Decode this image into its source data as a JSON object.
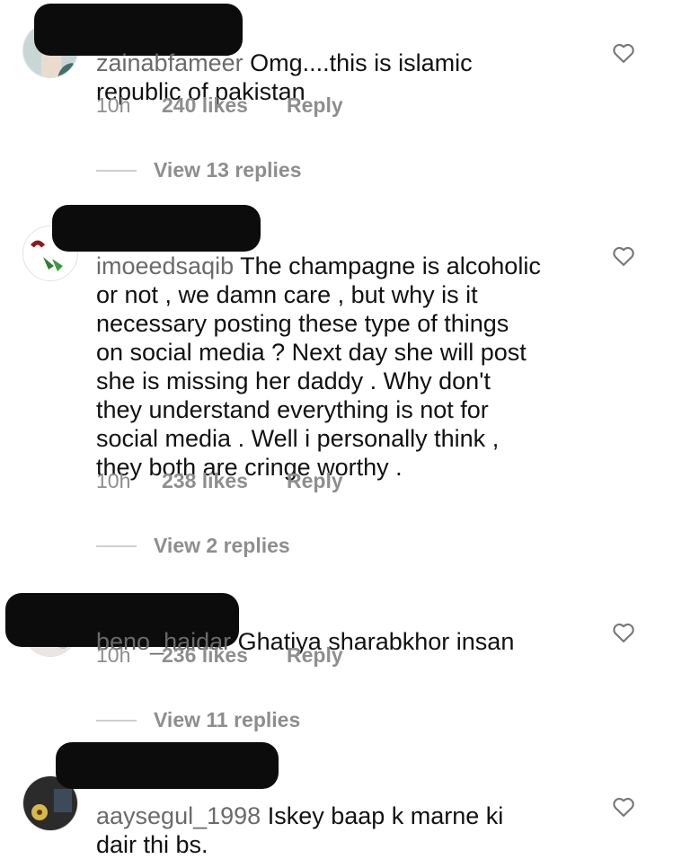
{
  "comments": [
    {
      "username": "zainabfameer",
      "text": "Omg....this is islamic\nrepublic of pakistan",
      "time": "10h",
      "likes": "240 likes",
      "reply": "Reply",
      "view_replies": "View 13 replies",
      "icons": {
        "like": "heart-icon",
        "avatar": "avatar"
      }
    },
    {
      "username": "imoeedsaqib",
      "text": "The champagne is alcoholic\nor not , we damn care , but why is it\nnecessary posting these type of things\non social media ? Next day she will post\nshe is missing her daddy . Why don't\nthey understand everything is not for\nsocial media . Well i personally think ,\nthey both are cringe worthy .",
      "time": "10h",
      "likes": "238 likes",
      "reply": "Reply",
      "view_replies": "View 2 replies",
      "icons": {
        "like": "heart-icon",
        "avatar": "avatar"
      }
    },
    {
      "username": "beno_haidar",
      "text": "Ghatiya sharabkhor insan",
      "time": "10h",
      "likes": "236 likes",
      "reply": "Reply",
      "view_replies": "View 11 replies",
      "icons": {
        "like": "heart-icon",
        "avatar": "avatar"
      }
    },
    {
      "username": "aaysegul_1998",
      "text": "Iskey baap k marne ki\ndair thi bs.",
      "icons": {
        "like": "heart-icon",
        "avatar": "avatar"
      }
    }
  ]
}
